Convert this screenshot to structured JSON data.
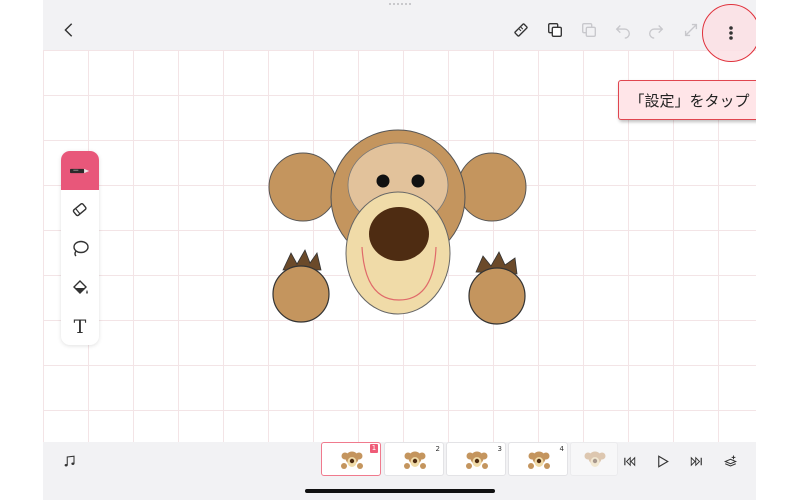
{
  "toolbar": {
    "back": "chevron-left-icon",
    "icons": [
      "ruler-icon",
      "copy-layer-icon",
      "layers-icon",
      "undo-icon",
      "redo-icon",
      "transform-icon",
      "more-vertical-icon"
    ]
  },
  "callout": {
    "text": "「設定」をタップ"
  },
  "tools": [
    "pen-icon",
    "eraser-icon",
    "lasso-icon",
    "bucket-fill-icon",
    "text-icon"
  ],
  "tools_text_glyph": "T",
  "timeline": {
    "frames": [
      {
        "number": "1",
        "selected": true
      },
      {
        "number": "2",
        "selected": false
      },
      {
        "number": "3",
        "selected": false
      },
      {
        "number": "4",
        "selected": false
      }
    ]
  },
  "playback": [
    "music-icon",
    "skip-back-icon",
    "play-icon",
    "skip-forward-icon",
    "add-frame-icon"
  ],
  "colors": {
    "accent": "#e8577a",
    "highlight_ring": "#e0323c",
    "callout_bg": "#ffe5e8",
    "bear_brown": "#c4955e",
    "bear_light": "#e2c29b",
    "muzzle": "#f0dba8",
    "nose": "#4e2c12"
  }
}
